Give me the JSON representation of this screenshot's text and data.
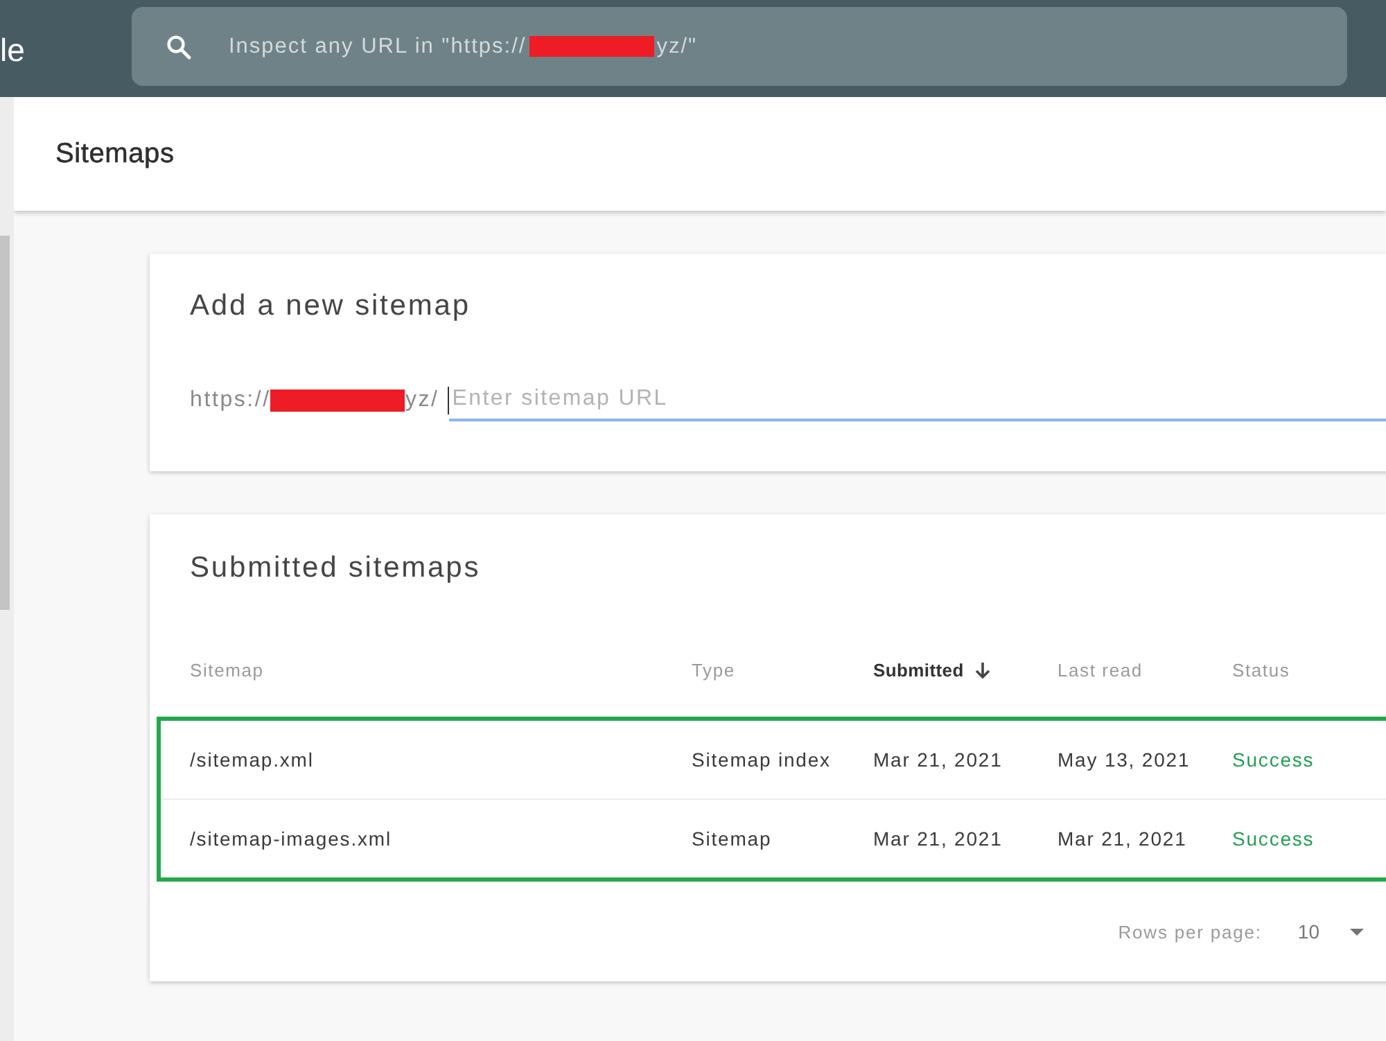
{
  "app_bar": {
    "product_name": "le",
    "search": {
      "placeholder": [
        {
          "kind": "text",
          "text": "Inspect any URL in \"https://"
        },
        {
          "kind": "redaction"
        },
        {
          "kind": "text",
          "text": "yz/\""
        }
      ]
    }
  },
  "page_header": {
    "title": "Sitemaps"
  },
  "add_sitemap": {
    "title": "Add a new sitemap",
    "url_prefix": [
      {
        "kind": "text",
        "text": "https://"
      },
      {
        "kind": "redaction"
      },
      {
        "kind": "text",
        "text": "yz/"
      }
    ],
    "input": {
      "placeholder": "Enter sitemap URL",
      "focused": true
    }
  },
  "submitted_sitemaps": {
    "title": "Submitted sitemaps",
    "table": {
      "highlighted": true,
      "columns": [
        {
          "label": "Sitemap",
          "sorted": false
        },
        {
          "label": "Type",
          "sorted": false
        },
        {
          "label": "Submitted",
          "sorted": true
        },
        {
          "label": "Last read",
          "sorted": false
        },
        {
          "label": "Status",
          "sorted": false
        }
      ],
      "rows": [
        {
          "cells": [
            "/sitemap.xml",
            "Sitemap index",
            "Mar 21, 2021",
            "May 13, 2021"
          ],
          "status": "Success",
          "color": "#22a052"
        },
        {
          "cells": [
            "/sitemap-images.xml",
            "Sitemap",
            "Mar 21, 2021",
            "Mar 21, 2021"
          ],
          "status": "Success",
          "color": "#22a052"
        }
      ]
    },
    "pagination": {
      "rows_per_page_label": "Rows per page:",
      "rows_per_page": "10"
    }
  }
}
